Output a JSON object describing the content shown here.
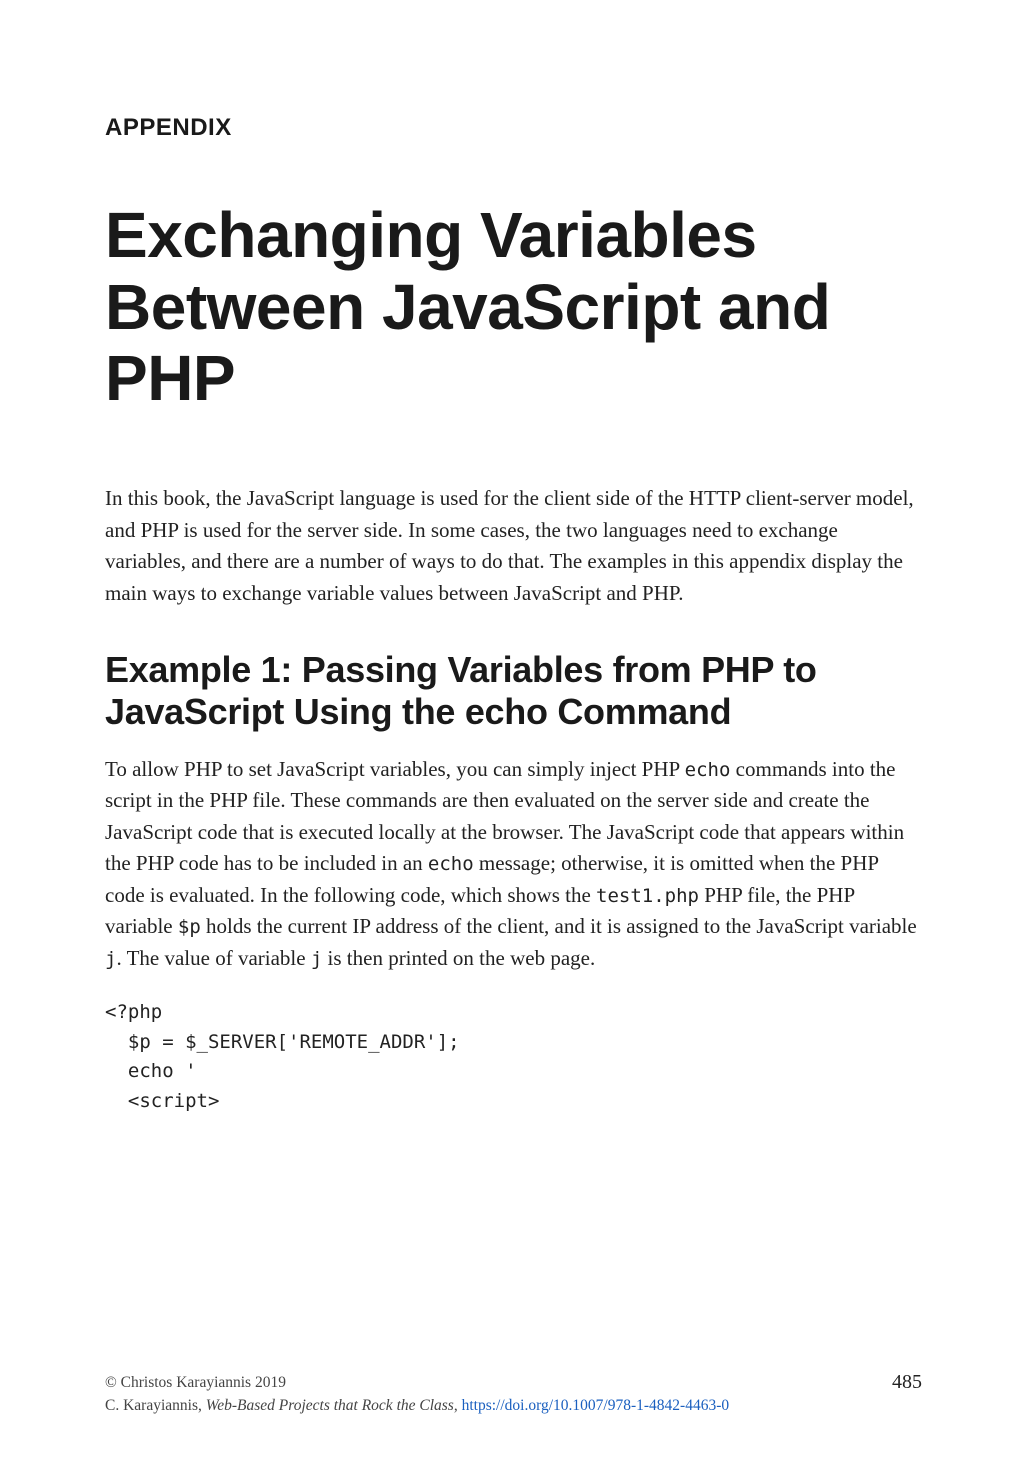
{
  "kicker": "APPENDIX",
  "title": "Exchanging Variables Between JavaScript and PHP",
  "intro": "In this book, the JavaScript language is used for the client side of the HTTP client-server model, and PHP is used for the server side. In some cases, the two languages need to exchange variables, and there are a number of ways to do that. The examples in this appendix display the main ways to exchange variable values between JavaScript and PHP.",
  "section1_heading": "Example 1: Passing Variables from PHP to JavaScript Using the echo Command",
  "section1_body": {
    "t1": "To allow PHP to set JavaScript variables, you can simply inject PHP ",
    "c1": "echo",
    "t2": " commands into the script in the PHP file. These commands are then evaluated on the server side and create the JavaScript code that is executed locally at the browser. The JavaScript code that appears within the PHP code has to be included in an ",
    "c2": "echo",
    "t3": " message; otherwise, it is omitted when the PHP code is evaluated. In the following code, which shows the ",
    "c3": "test1.php",
    "t4": " PHP file, the PHP variable ",
    "c4": "$p",
    "t5": " holds the current IP address of the client, and it is assigned to the JavaScript variable ",
    "c5": "j",
    "t6": ". The value of variable ",
    "c6": "j",
    "t7": " is then printed on the web page."
  },
  "code_block": "<?php\n  $p = $_SERVER['REMOTE_ADDR'];\n  echo '\n  <script>",
  "footer": {
    "copyright": "© Christos Karayiannis 2019",
    "credit_prefix": "C. Karayiannis, ",
    "book_title": "Web-Based Projects that Rock the Class",
    "credit_sep": ", ",
    "doi": "https://doi.org/10.1007/978-1-4842-4463-0",
    "page_number": "485"
  }
}
